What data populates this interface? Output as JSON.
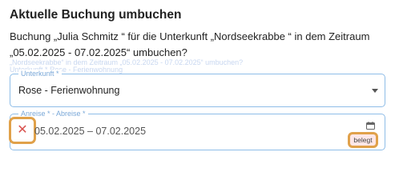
{
  "dialog": {
    "title": "Aktuelle Buchung umbuchen",
    "description": "Buchung „Julia Schmitz “ für die Unterkunft „Nordseekrabbe “ in dem Zeitraum „05.02.2025 - 07.02.2025“ umbuchen?"
  },
  "background_ghost": {
    "line1": "„Nordseekrabbe“ in dem Zeitraum „05.02.2025 - 07.02.2025“ umbuchen?",
    "line2": "Unterkunft *  Rose - Ferienwohnung"
  },
  "unterkunft_field": {
    "label": "Unterkunft *",
    "value": "Rose - Ferienwohnung"
  },
  "date_field": {
    "label": "Anreise * - Abreise *",
    "value": "05.02.2025 – 07.02.2025",
    "status": "belegt"
  },
  "icons": {
    "clear": "close-icon",
    "calendar": "calendar-icon",
    "dropdown": "chevron-down-icon"
  },
  "colors": {
    "field_border": "#8fbde8",
    "highlight": "#e0a14a",
    "clear_icon": "#d9534f",
    "status_bg": "#fde7e7"
  }
}
